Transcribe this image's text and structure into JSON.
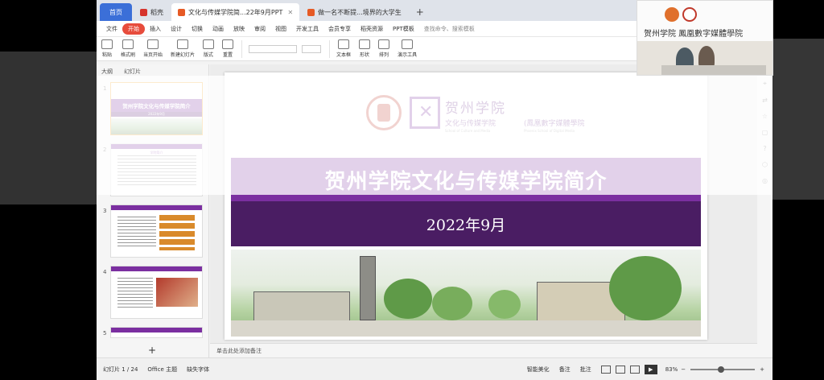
{
  "tabs": [
    {
      "label": "首页",
      "kind": "home"
    },
    {
      "label": "稻壳",
      "kind": "normal",
      "icon_color": "#d6342c"
    },
    {
      "label": "文化与传媒学院简...22年9月PPT",
      "kind": "active",
      "icon_color": "#e65a25"
    },
    {
      "label": "做一名不断提...境界的大学生",
      "kind": "normal",
      "icon_color": "#e65a25"
    }
  ],
  "tab_plus": "+",
  "menubar": {
    "items": [
      "文件",
      "开始",
      "插入",
      "设计",
      "切换",
      "动画",
      "放映",
      "审阅",
      "视图",
      "开发工具",
      "会员专享",
      "稻壳资源",
      "PPT模板"
    ],
    "search_placeholder": "查找命令、搜索模板"
  },
  "ribbon": {
    "buttons": [
      "粘贴",
      "格式刷",
      "当页开始",
      "新建幻灯片",
      "版式",
      "重置",
      "文本框",
      "形状",
      "排列",
      "演示工具"
    ]
  },
  "sidebar": {
    "tabs": [
      "大纲",
      "幻灯片"
    ],
    "thumbs": [
      {
        "num": "1",
        "title": "贺州学院文化与传媒学院简介",
        "sub": "2022年9月"
      },
      {
        "num": "2",
        "title": "学院简介"
      },
      {
        "num": "3"
      },
      {
        "num": "4"
      },
      {
        "num": "5"
      }
    ],
    "add_label": "+"
  },
  "slide": {
    "calligraphy_top": "贺州学院",
    "calligraphy_left": "文化与传媒学院",
    "calligraphy_right": "(鳳凰數字媒體學院",
    "english_left": "School of Culture and Media",
    "english_right": "Phoenix School of Digital Media",
    "title": "贺州学院文化与传媒学院简介",
    "date": "2022年9月"
  },
  "notes_placeholder": "单击此处添加备注",
  "status": {
    "slide_count": "幻灯片 1 / 24",
    "theme": "Office 主题",
    "missing_font": "缺失字体",
    "smart_beautify": "智能美化",
    "notes": "备注",
    "comments": "批注",
    "zoom": "83%"
  },
  "webcam": {
    "text": "贺州学院  鳳凰數字媒體學院"
  },
  "colors": {
    "accent": "#7b2fa0",
    "accent_dark": "#4a1d63",
    "home_tab": "#3b6fd8",
    "start_tab": "#e74c3c"
  }
}
